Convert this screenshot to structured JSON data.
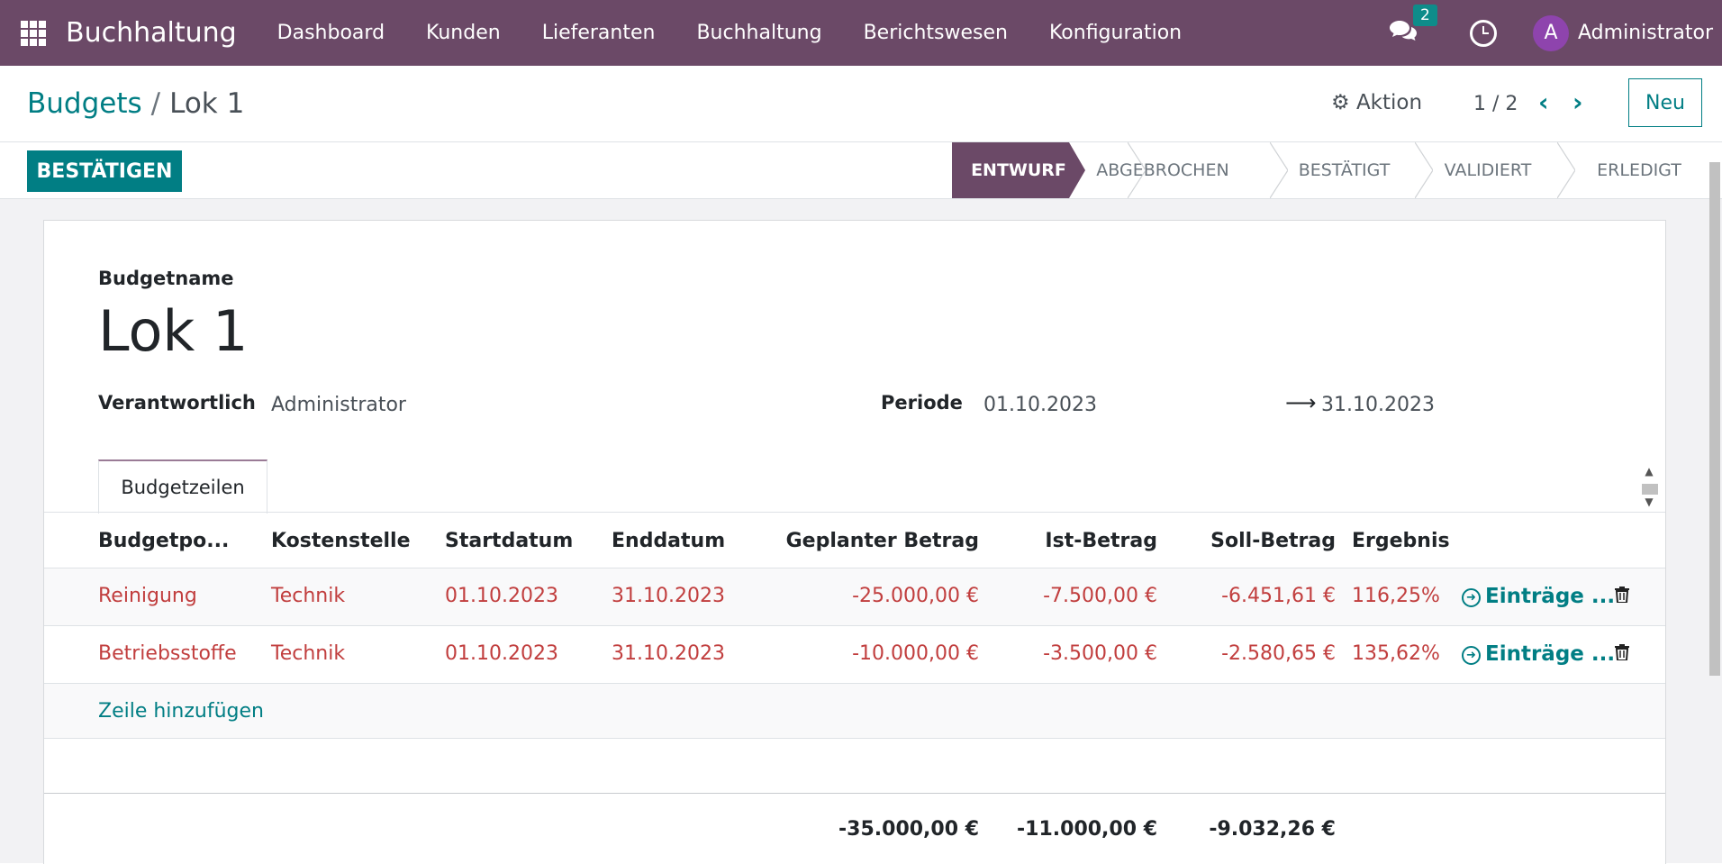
{
  "navbar": {
    "brand": "Buchhaltung",
    "menu": [
      "Dashboard",
      "Kunden",
      "Lieferanten",
      "Buchhaltung",
      "Berichtswesen",
      "Konfiguration"
    ],
    "chat_count": "2",
    "avatar_initial": "A",
    "user": "Administrator"
  },
  "control": {
    "breadcrumb_parent": "Budgets",
    "breadcrumb_sep": "/",
    "breadcrumb_current": "Lok 1",
    "action_label": "Aktion",
    "pager": "1 / 2",
    "new_label": "Neu"
  },
  "statusbar": {
    "confirm_label": "BESTÄTIGEN",
    "stages": [
      "ENTWURF",
      "ABGEBROCHEN",
      "BESTÄTIGT",
      "VALIDIERT",
      "ERLEDIGT"
    ],
    "active_stage": "ENTWURF"
  },
  "form": {
    "name_label": "Budgetname",
    "name": "Lok 1",
    "responsible_label": "Verantwortlich",
    "responsible": "Administrator",
    "period_label": "Periode",
    "period_start": "01.10.2023",
    "period_end": "31.10.2023",
    "tab_label": "Budgetzeilen"
  },
  "table": {
    "headers": [
      "Budgetpo...",
      "Kostenstelle",
      "Startdatum",
      "Enddatum",
      "Geplanter Betrag",
      "Ist-Betrag",
      "Soll-Betrag",
      "Ergebnis"
    ],
    "rows": [
      {
        "position": "Reinigung",
        "cost_center": "Technik",
        "start": "01.10.2023",
        "end": "31.10.2023",
        "planned": "-25.000,00 €",
        "actual": "-7.500,00 €",
        "theoretical": "-6.451,61 €",
        "result": "116,25%",
        "entries": "Einträge ..."
      },
      {
        "position": "Betriebsstoffe",
        "cost_center": "Technik",
        "start": "01.10.2023",
        "end": "31.10.2023",
        "planned": "-10.000,00 €",
        "actual": "-3.500,00 €",
        "theoretical": "-2.580,65 €",
        "result": "135,62%",
        "entries": "Einträge ..."
      }
    ],
    "add_line": "Zeile hinzufügen",
    "totals": {
      "planned": "-35.000,00 €",
      "actual": "-11.000,00 €",
      "theoretical": "-9.032,26 €"
    }
  },
  "colors": {
    "navbar": "#6b4967",
    "primary": "#017e84",
    "negative": "#c13e3e"
  }
}
